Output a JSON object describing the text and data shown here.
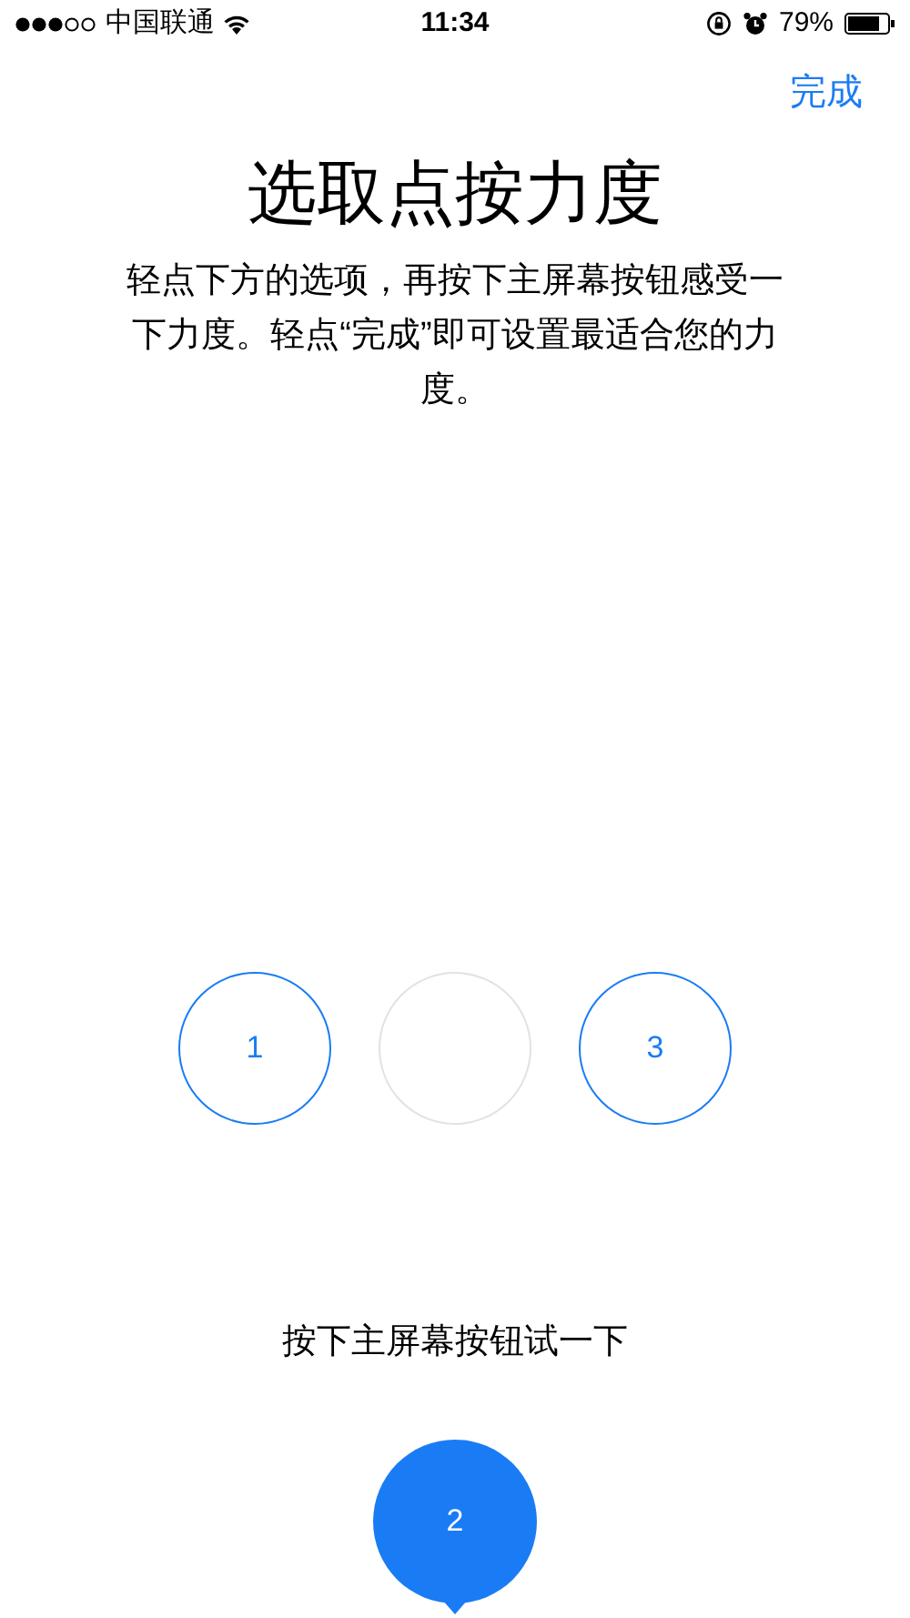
{
  "status_bar": {
    "carrier": "中国联通",
    "time": "11:34",
    "battery": "79%"
  },
  "nav": {
    "done": "完成"
  },
  "title": "选取点按力度",
  "description": "轻点下方的选项，再按下主屏幕按钮感受一下力度。轻点“完成”即可设置最适合您的力度。",
  "options": [
    {
      "label": "1",
      "selected": false
    },
    {
      "label": "2",
      "selected": true
    },
    {
      "label": "3",
      "selected": false
    }
  ],
  "hint": "按下主屏幕按钮试一下"
}
